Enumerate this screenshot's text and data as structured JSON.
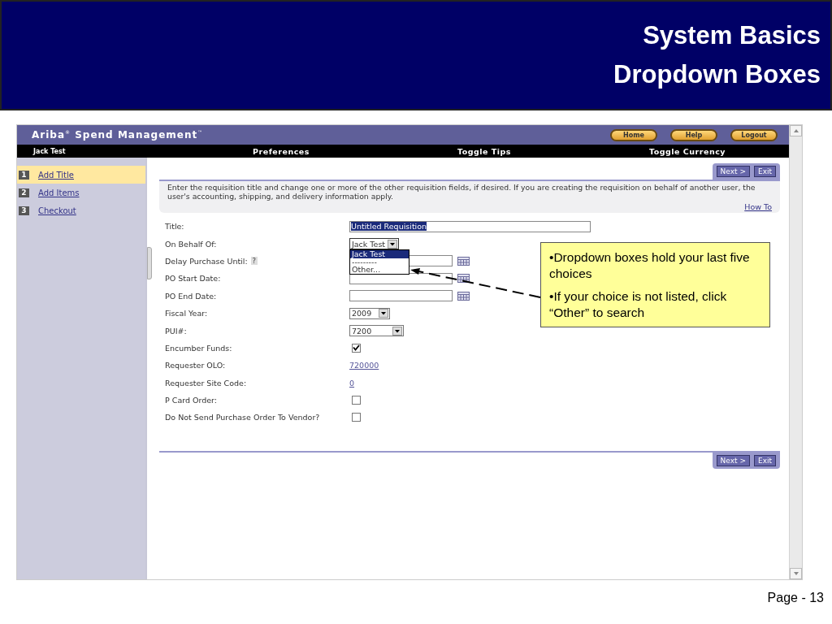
{
  "slide": {
    "title_lines": [
      "System Basics",
      "Dropdown  Boxes"
    ],
    "page": "Page - 13"
  },
  "app": {
    "brand": "Ariba$^{®}$ Spend Management$^{™}$",
    "header_buttons": [
      "Home",
      "Help",
      "Logout"
    ],
    "user": "Jack Test",
    "nav": [
      "Preferences",
      "Toggle Tips",
      "Toggle Currency"
    ]
  },
  "steps": [
    {
      "number": "1",
      "label": "Add Title",
      "selected": true
    },
    {
      "number": "2",
      "label": "Add Items",
      "selected": false
    },
    {
      "number": "3",
      "label": "Checkout",
      "selected": false
    }
  ],
  "top_buttons": [
    "Next >",
    "Exit"
  ],
  "instructions": "Enter the requisition title and change one or more of the other requisition fields, if desired. If you are creating the requisition on behalf of another user, the user's accounting, shipping, and delivery information apply.",
  "how_to": "How To",
  "fields": [
    {
      "label": "Title:",
      "kind": "text",
      "value": "Untitled Requisition",
      "highlighted": true
    },
    {
      "label": "On Behalf Of:",
      "kind": "select",
      "value": "Jack Test",
      "open": true,
      "options": [
        {
          "label": "Jack Test",
          "selected": true
        },
        {
          "label": "---------",
          "selected": false
        },
        {
          "label": "Other...",
          "selected": false
        }
      ]
    },
    {
      "label": "Delay Purchase Until:",
      "kind": "date",
      "help": "?"
    },
    {
      "label": "PO Start Date:",
      "kind": "date"
    },
    {
      "label": "PO End Date:",
      "kind": "date"
    },
    {
      "label": "Fiscal Year:",
      "kind": "select",
      "value": "2009"
    },
    {
      "label": "PUI#:",
      "kind": "select",
      "value": "7200",
      "wide": true
    },
    {
      "label": "Encumber Funds:",
      "kind": "checkbox",
      "checked": true
    },
    {
      "label": "Requester OLO:",
      "kind": "link",
      "value": "720000"
    },
    {
      "label": "Requester Site Code:",
      "kind": "link",
      "value": "0"
    },
    {
      "label": "P Card Order:",
      "kind": "checkbox",
      "checked": false
    },
    {
      "label": "Do Not Send Purchase Order To Vendor?",
      "kind": "checkbox",
      "checked": false
    }
  ],
  "bottom_buttons": [
    "Next >",
    "Exit"
  ],
  "callout": {
    "bullets": [
      "•Dropdown boxes hold your last five choices",
      "•If your choice is not listed, click “Other” to search"
    ]
  }
}
